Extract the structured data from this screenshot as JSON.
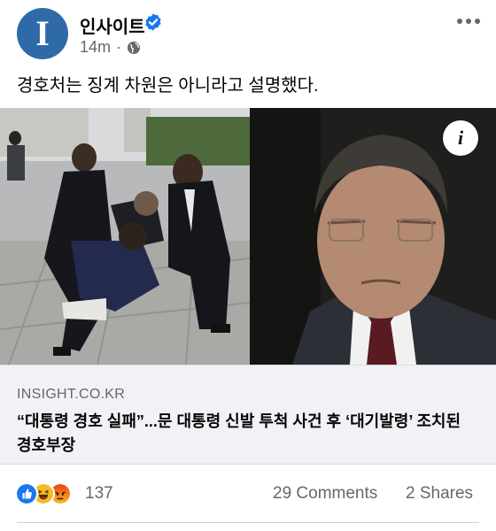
{
  "post": {
    "avatar_letter": "I",
    "page_name": "인사이트",
    "time": "14m",
    "dot": "·",
    "caption": "경호처는 징계 차원은 아니라고 설명했다."
  },
  "link": {
    "domain": "INSIGHT.CO.KR",
    "headline": "“대통령 경호 실패”...문 대통령 신발 투척 사건 후 ‘대기발령’ 조치된 경호부장"
  },
  "stats": {
    "reaction_count": "137",
    "comments": "29 Comments",
    "shares": "2 Shares"
  },
  "colors": {
    "avatar_bg": "#2f6aa8",
    "verified": "#1877f2",
    "meta_text": "#65676b",
    "link_card_bg": "#f0f2f5",
    "like": "#1877f2",
    "haha": "#f7b928",
    "angry": "#e9710f"
  },
  "icons": [
    "avatar-logo",
    "verified-icon",
    "globe-icon",
    "more-options-icon",
    "info-icon",
    "like-reaction-icon",
    "haha-reaction-icon",
    "angry-reaction-icon"
  ]
}
